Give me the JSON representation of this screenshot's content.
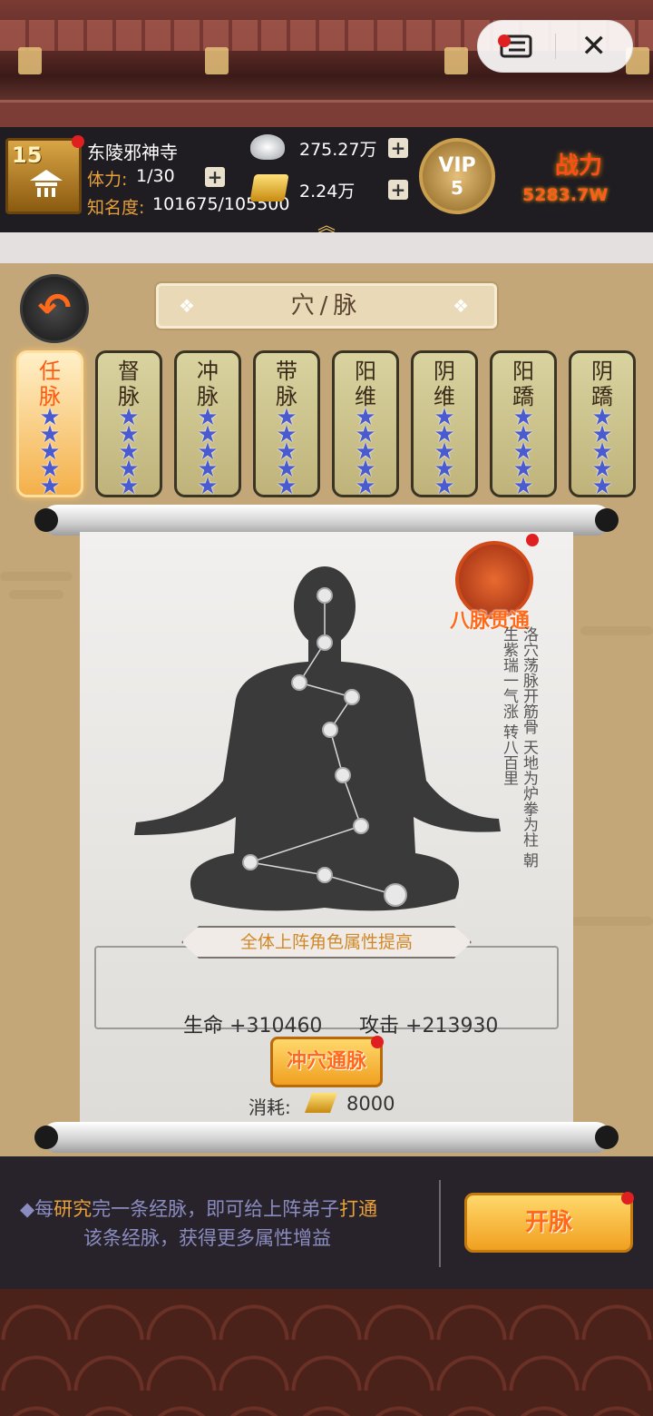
{
  "header": {
    "menu_icon": "menu-capsule-icon",
    "close_label": "✕"
  },
  "player": {
    "level": "15",
    "name": "东陵邪神寺",
    "stamina_label": "体力:",
    "stamina_value": "1/30",
    "fame_label": "知名度:",
    "fame_value": "101675/105500",
    "silver": "275.27万",
    "gold": "2.24万",
    "vip_label": "VIP",
    "vip_level": "5",
    "power_label": "战力",
    "power_value": "5283.7W"
  },
  "page": {
    "title": "穴/脉",
    "back_icon": "back-arrow-icon"
  },
  "tabs": [
    {
      "label": "任脉",
      "stars": 5,
      "active": true
    },
    {
      "label": "督脉",
      "stars": 5,
      "active": false
    },
    {
      "label": "冲脉",
      "stars": 5,
      "active": false
    },
    {
      "label": "带脉",
      "stars": 5,
      "active": false
    },
    {
      "label": "阳维",
      "stars": 5,
      "active": false
    },
    {
      "label": "阴维",
      "stars": 5,
      "active": false
    },
    {
      "label": "阳蹻",
      "stars": 5,
      "active": false
    },
    {
      "label": "阴蹻",
      "stars": 5,
      "active": false
    }
  ],
  "scroll": {
    "badge_label": "八脉贯通",
    "poem": "洛穴荡脉开筋骨 天地为炉拳为柱 朝生紫瑞一气涨 转八百里",
    "buff_title": "全体上阵角色属性提高",
    "stat_hp_label": "生命",
    "stat_hp_value": "+310460",
    "stat_atk_label": "攻击",
    "stat_atk_value": "+213930",
    "action_label": "冲穴通脉",
    "cost_label": "消耗:",
    "cost_value": "8000"
  },
  "footer": {
    "tip_prefix": "◆每",
    "tip_hl1": "研究",
    "tip_mid": "完一条经脉，即可给上阵弟子",
    "tip_hl2": "打通",
    "tip_line2": "该条经脉，获得更多属性增益",
    "open_label": "开脉"
  },
  "colors": {
    "accent_orange": "#ff6a1a",
    "gold_label": "#e9a23b",
    "panel_bg": "#c3a778"
  }
}
